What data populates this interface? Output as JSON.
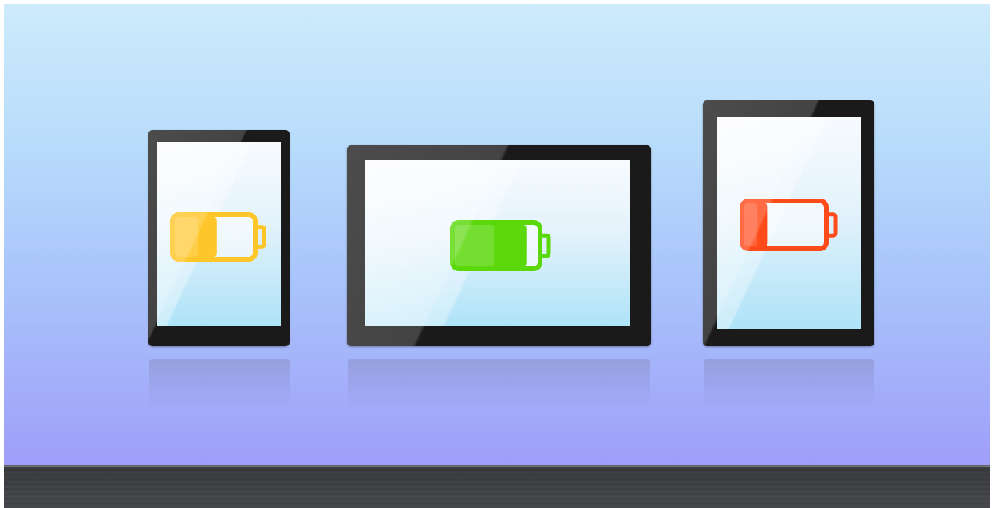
{
  "scene": {
    "description_free": true,
    "colors": {
      "sky_top": "#cdebfb",
      "sky_bottom": "#9f9ef9",
      "floor": "#808285",
      "bezel": "#1a1a1a"
    }
  },
  "devices": [
    {
      "kind": "phone",
      "battery_level": 0.55,
      "battery_color": "#ffc629",
      "icon": "battery-half-icon"
    },
    {
      "kind": "tablet-landscape",
      "battery_level": 0.88,
      "battery_color": "#5ad80a",
      "icon": "battery-full-icon"
    },
    {
      "kind": "tablet-portrait",
      "battery_level": 0.3,
      "battery_color": "#ff4a1a",
      "icon": "battery-low-icon"
    }
  ]
}
